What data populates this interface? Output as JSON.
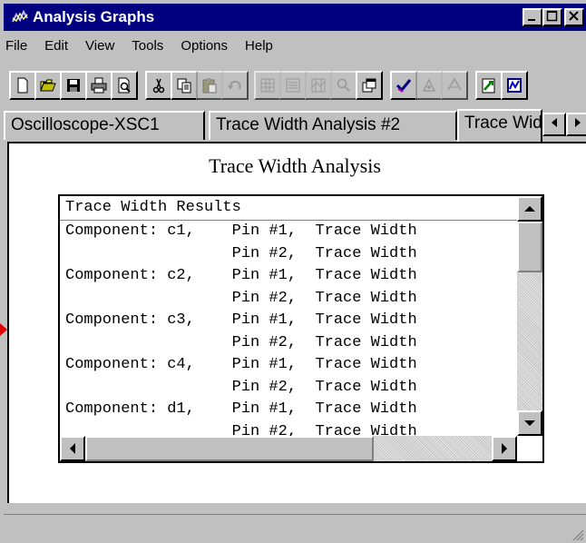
{
  "window": {
    "title": "Analysis Graphs"
  },
  "menu": {
    "items": [
      "File",
      "Edit",
      "View",
      "Tools",
      "Options",
      "Help"
    ]
  },
  "tabs": [
    {
      "label": "Oscilloscope-XSC1"
    },
    {
      "label": "Trace Width Analysis #2"
    },
    {
      "label": "Trace Width Analysis"
    }
  ],
  "graph": {
    "title": "Trace Width Analysis",
    "results_header": "Trace Width Results",
    "rows": [
      "Component: c1,    Pin #1,  Trace Width",
      "                  Pin #2,  Trace Width",
      "Component: c2,    Pin #1,  Trace Width",
      "                  Pin #2,  Trace Width",
      "Component: c3,    Pin #1,  Trace Width",
      "                  Pin #2,  Trace Width",
      "Component: c4,    Pin #1,  Trace Width",
      "                  Pin #2,  Trace Width",
      "Component: d1,    Pin #1,  Trace Width",
      "                  Pin #2,  Trace Width"
    ]
  },
  "colors": {
    "titlebar": "#000080",
    "marker": "#e00000",
    "chrome": "#c0c0c0"
  }
}
